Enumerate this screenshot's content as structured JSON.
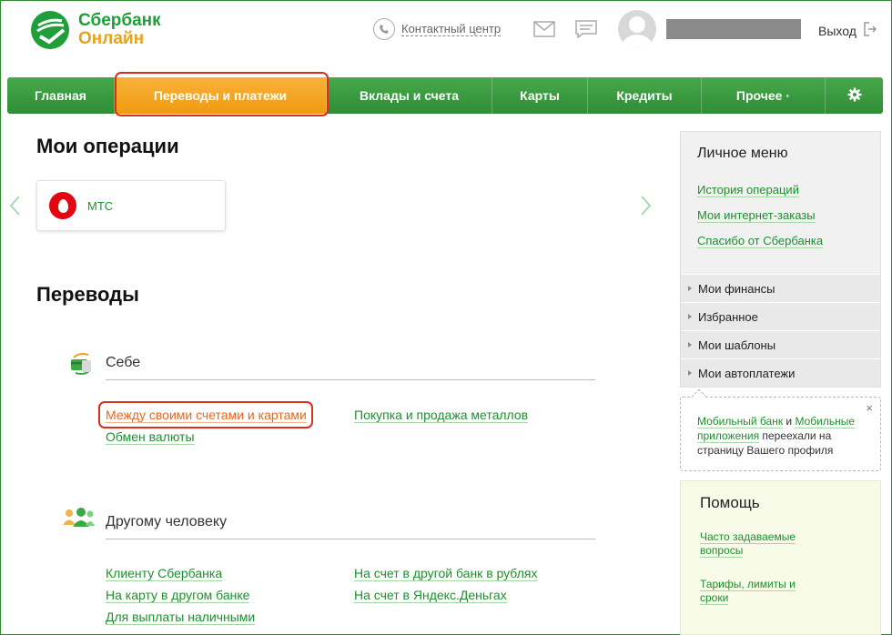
{
  "header": {
    "logo_line1": "Сбербанк",
    "logo_line2": "Онлайн",
    "contact_center": "Контактный центр",
    "logout": "Выход"
  },
  "nav": {
    "items": [
      {
        "label": "Главная"
      },
      {
        "label": "Переводы и платежи"
      },
      {
        "label": "Вклады и счета"
      },
      {
        "label": "Карты"
      },
      {
        "label": "Кредиты"
      },
      {
        "label": "Прочее"
      }
    ],
    "dropdown_glyph": "·",
    "active_index": 1
  },
  "operations": {
    "title": "Мои операции",
    "items": [
      {
        "label": "МТС"
      }
    ]
  },
  "transfers": {
    "title": "Переводы",
    "self": {
      "title": "Себе",
      "links": [
        "Между своими счетами и картами",
        "Покупка и продажа металлов",
        "Обмен валюты"
      ]
    },
    "other": {
      "title": "Другому человеку",
      "links": [
        "Клиенту Сбербанка",
        "На счет в другой банк в рублях",
        "На карту в другом банке",
        "На счет в Яндекс.Деньгах",
        "Для выплаты наличными"
      ]
    }
  },
  "personal_menu": {
    "title": "Личное меню",
    "links": [
      "История операций",
      "Мои интернет-заказы",
      "Спасибо от Сбербанка"
    ],
    "sections": [
      "Мои финансы",
      "Избранное",
      "Мои шаблоны",
      "Мои автоплатежи"
    ]
  },
  "notice": {
    "link1": "Мобильный банк",
    "and": " и ",
    "link2": "Мобильные приложения",
    "rest": " переехали на страницу Вашего профиля",
    "close": "×"
  },
  "help": {
    "title": "Помощь",
    "links": [
      "Часто задаваемые вопросы",
      "Тарифы, лимиты и сроки"
    ]
  },
  "colors": {
    "brand_green": "#2f8d36",
    "accent_orange": "#f09a12",
    "highlight_red": "#d8301c",
    "link_green": "#1f8f2f"
  }
}
